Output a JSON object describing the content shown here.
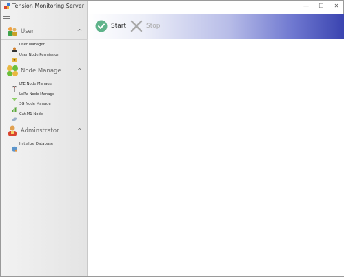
{
  "app": {
    "title": "Tension Monitoring Server"
  },
  "window_controls": {
    "minimize": "—",
    "maximize": "☐",
    "close": "✕"
  },
  "sidebar": {
    "sections": [
      {
        "label": "User",
        "chevron": "^",
        "items": [
          {
            "label": "User Manager",
            "icon": "user-icon"
          },
          {
            "label": "User Node Permission",
            "icon": "permission-icon"
          }
        ]
      },
      {
        "label": "Node Manage",
        "chevron": "^",
        "items": [
          {
            "label": "LTE Node Manage",
            "icon": "lte-antenna-icon"
          },
          {
            "label": "LoRa Node Manage",
            "icon": "lora-icon"
          },
          {
            "label": "3G Node Manage",
            "icon": "signal-icon"
          },
          {
            "label": "Cat.M1 Node",
            "icon": "catm1-icon"
          }
        ]
      },
      {
        "label": "Adminstrator",
        "chevron": "^",
        "items": [
          {
            "label": "Initialize Database",
            "icon": "database-icon"
          }
        ]
      }
    ]
  },
  "toolbar": {
    "start_label": "Start",
    "stop_label": "Stop"
  },
  "colors": {
    "accent": "#3a44b0",
    "start_green": "#5fb38a",
    "stop_gray": "#a9a9a9"
  }
}
